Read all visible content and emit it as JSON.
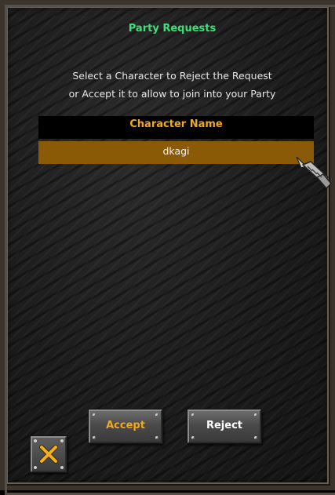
{
  "window": {
    "title": "Party Requests",
    "instruction_line1": "Select a Character to Reject the Request",
    "instruction_line2": "or Accept it to allow to join into your Party"
  },
  "list": {
    "column_header": "Character Name",
    "rows": [
      {
        "name": "dkagi",
        "selected": true
      }
    ]
  },
  "buttons": {
    "accept_label": "Accept",
    "reject_label": "Reject",
    "close_icon": "close-x-icon"
  },
  "colors": {
    "title": "#3fe07a",
    "header_text": "#f0a81e",
    "selected_row": "#8a5a07",
    "accept_text": "#f0a81e",
    "reject_text": "#ffffff"
  }
}
